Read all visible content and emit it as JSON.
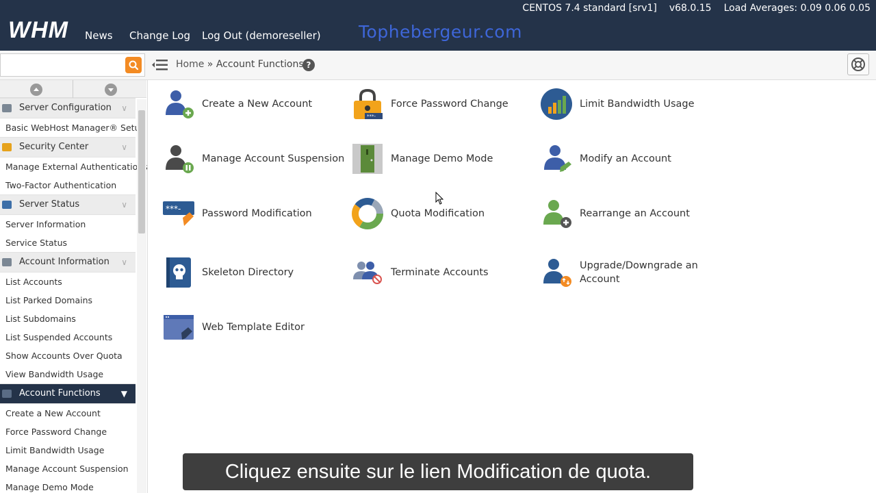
{
  "topbar": {
    "logo": "WHM",
    "nav": [
      "News",
      "Change Log",
      "Log Out (demoreseller)"
    ],
    "brand": "Tophebergeur.com",
    "os": "CENTOS 7.4 standard [srv1]",
    "version": "v68.0.15",
    "load": "Load Averages: 0.09 0.06 0.05",
    "bg_color": "#243349"
  },
  "search": {
    "value": "",
    "placeholder": ""
  },
  "breadcrumb": {
    "home": "Home",
    "separator": "»",
    "current": "Account Functions"
  },
  "sidebar": {
    "sections": [
      {
        "title": "Server Configuration",
        "icon": "server-config-icon",
        "items": [
          "Basic WebHost Manager® Setup"
        ]
      },
      {
        "title": "Security Center",
        "icon": "lock-icon",
        "items": [
          "Manage External Authentications",
          "Two-Factor Authentication"
        ]
      },
      {
        "title": "Server Status",
        "icon": "monitor-icon",
        "items": [
          "Server Information",
          "Service Status"
        ]
      },
      {
        "title": "Account Information",
        "icon": "account-info-icon",
        "items": [
          "List Accounts",
          "List Parked Domains",
          "List Subdomains",
          "List Suspended Accounts",
          "Show Accounts Over Quota",
          "View Bandwidth Usage"
        ]
      },
      {
        "title": "Account Functions",
        "icon": "account-functions-icon",
        "active": true,
        "items": [
          "Create a New Account",
          "Force Password Change",
          "Limit Bandwidth Usage",
          "Manage Account Suspension",
          "Manage Demo Mode"
        ]
      }
    ]
  },
  "functions": [
    {
      "label": "Create a New Account",
      "icon": "user-add-icon"
    },
    {
      "label": "Force Password Change",
      "icon": "padlock-icon"
    },
    {
      "label": "Limit Bandwidth Usage",
      "icon": "bandwidth-chart-icon"
    },
    {
      "label": "Manage Account Suspension",
      "icon": "user-pause-icon"
    },
    {
      "label": "Manage Demo Mode",
      "icon": "demo-door-icon"
    },
    {
      "label": "Modify an Account",
      "icon": "user-edit-icon"
    },
    {
      "label": "Password Modification",
      "icon": "password-pen-icon"
    },
    {
      "label": "Quota Modification",
      "icon": "pie-quota-icon"
    },
    {
      "label": "Rearrange an Account",
      "icon": "user-move-icon"
    },
    {
      "label": "Skeleton Directory",
      "icon": "skull-book-icon"
    },
    {
      "label": "Terminate Accounts",
      "icon": "users-terminate-icon"
    },
    {
      "label": "Upgrade/Downgrade an Account",
      "label_lines": [
        "Upgrade/Downgrade an",
        "Account"
      ],
      "icon": "user-upgrade-icon"
    },
    {
      "label": "Web Template Editor",
      "icon": "web-template-icon"
    }
  ],
  "caption": "Cliquez ensuite sur le lien Modification de quota."
}
